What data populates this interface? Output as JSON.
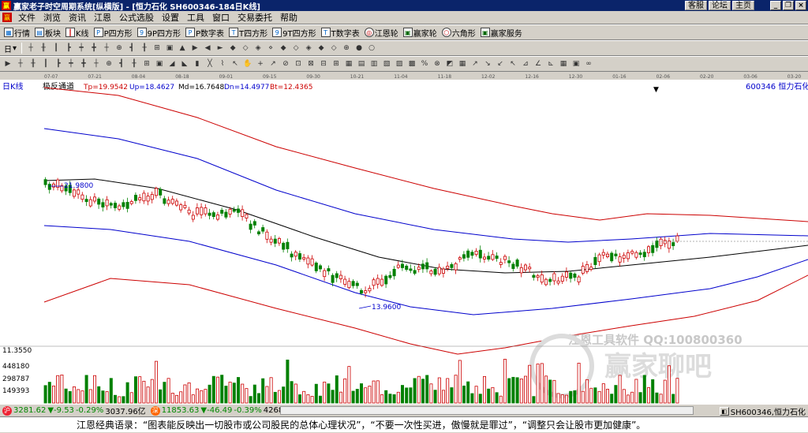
{
  "window": {
    "title": "赢家老子时空周期系统[纵横版] - [恒力石化  SH600346-184日K线]",
    "links": [
      "客服",
      "论坛",
      "主页"
    ]
  },
  "menu": [
    "文件",
    "浏览",
    "资讯",
    "江恩",
    "公式选股",
    "设置",
    "工具",
    "窗口",
    "交易委托",
    "帮助"
  ],
  "toolbar1": [
    {
      "icon": "grid-icon",
      "label": "行情"
    },
    {
      "icon": "blocks-icon",
      "label": "板块"
    },
    {
      "icon": "candle-icon",
      "label": "K线"
    },
    {
      "icon": "p-square-icon",
      "label": "P四方形"
    },
    {
      "icon": "9p-square-icon",
      "label": "9P四方形"
    },
    {
      "icon": "p-number-icon",
      "label": "P数字表"
    },
    {
      "icon": "t-square-icon",
      "label": "T四方形"
    },
    {
      "icon": "9t-square-icon",
      "label": "9T四方形"
    },
    {
      "icon": "t-number-icon",
      "label": "T数字表"
    },
    {
      "icon": "gann-wheel-icon",
      "label": "江恩轮"
    },
    {
      "icon": "winner-wheel-icon",
      "label": "赢家轮"
    },
    {
      "icon": "hexagon-icon",
      "label": "六角形"
    },
    {
      "icon": "service-icon",
      "label": "赢家服务"
    }
  ],
  "toolbar2_first": "日",
  "chart": {
    "period": "日K线",
    "indicator": "极反通道",
    "tp": "Tp=19.9542",
    "up": "Up=18.4627",
    "md": "Md=16.7648",
    "dn": "Dn=14.4977",
    "bt": "Bt=12.4365",
    "stock": "600346  恒力石化",
    "high_label": "21.9800",
    "low_label": "13.9600",
    "date_ticks": [
      "07-07",
      "07-21",
      "08-04",
      "08-18",
      "09-01",
      "09-15",
      "09-30",
      "10-21",
      "11-04",
      "11-18",
      "12-02",
      "12-16",
      "12-30",
      "01-16",
      "02-06",
      "02-20",
      "03-06",
      "03-20",
      "04-03"
    ],
    "vol_labels": [
      "11.3550",
      "448180",
      "298787",
      "149393"
    ],
    "watermark1": "江恩工具软件  QQ:100800360",
    "watermark2": "赢家聊吧",
    "colors": {
      "red": "#cc0000",
      "blue": "#0000cc",
      "green": "#008000",
      "black": "#000000"
    }
  },
  "status": {
    "sh_value": "3281.62",
    "sh_change": "▼-9.53",
    "sh_pct": "-0.29%",
    "sh_amount": "3037.96亿",
    "sz_value": "11853.63",
    "sz_change": "▼-46.49",
    "sz_pct": "-0.39%",
    "sz_amount": "4268.7",
    "code": "SH600346,恒力石化"
  },
  "quote": "江恩经典语录：“图表能反映出一切股市或公司股民的总体心理状况”，“不要一次性买进，傲慢就是罪过”，“调整只会让股市更加健康”。"
}
